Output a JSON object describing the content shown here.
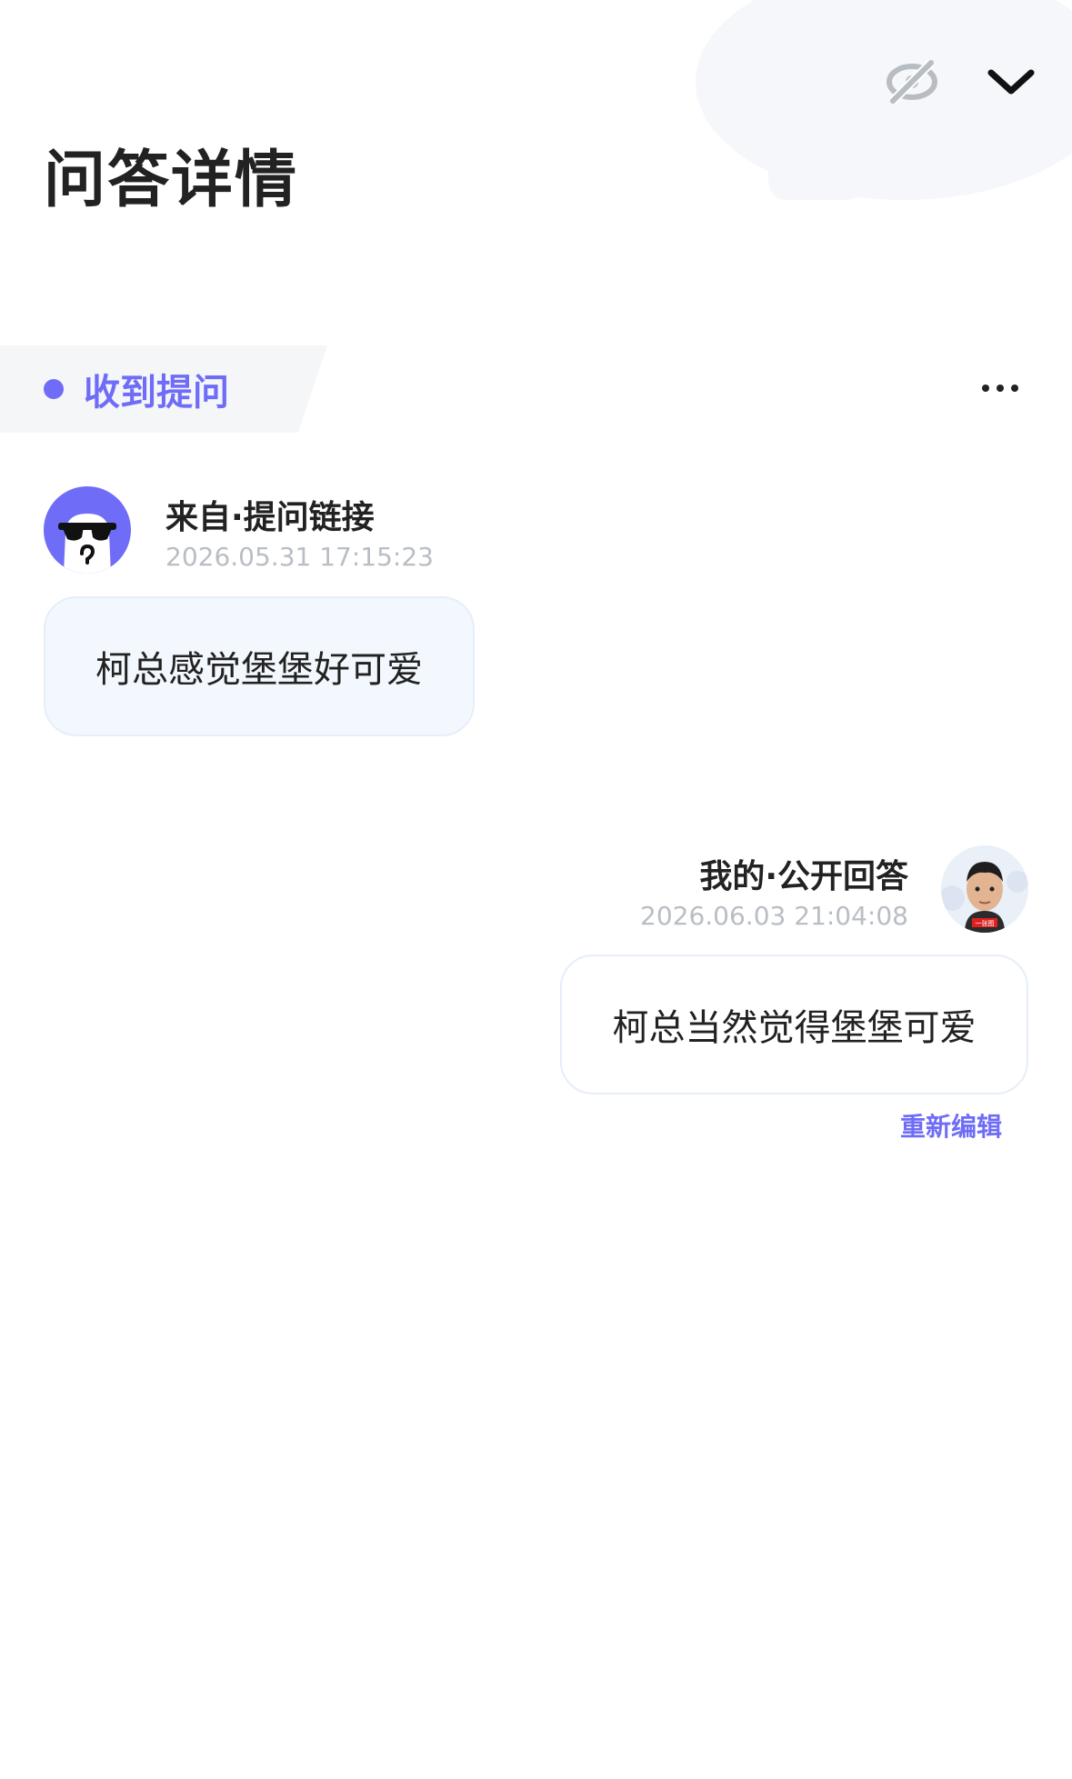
{
  "header": {
    "title": "问答详情"
  },
  "section": {
    "label": "收到提问"
  },
  "question": {
    "source": "来自·提问链接",
    "time": "2026.05.31 17:15:23",
    "text": "柯总感觉堡堡好可爱"
  },
  "answer": {
    "author": "我的·公开回答",
    "time": "2026.06.03 21:04:08",
    "text": "柯总当然觉得堡堡可爱",
    "avatar_badge": "一张图",
    "edit_label": "重新编辑"
  },
  "colors": {
    "accent": "#6f6cf7",
    "muted": "#b9bdc4",
    "bubble_tint": "#f3f8fe"
  },
  "icons": {
    "visibility": "eye-off-icon",
    "collapse": "chevron-down-icon",
    "more": "more-horizontal-icon"
  }
}
